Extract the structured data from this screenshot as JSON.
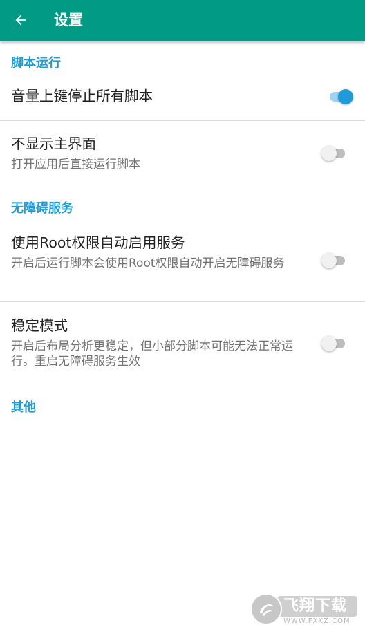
{
  "colors": {
    "appbar": "#009a85",
    "accent": "#1e9bd8",
    "title_text": "#212121",
    "summary_text": "#737373",
    "divider": "#dcdcdc"
  },
  "appbar": {
    "back_icon": "arrow-left-icon",
    "title": "设置"
  },
  "sections": [
    {
      "header": "脚本运行",
      "prefs": [
        {
          "title": "音量上键停止所有脚本",
          "summary": "",
          "switch_on": true
        },
        {
          "title": "不显示主界面",
          "summary": "打开应用后直接运行脚本",
          "switch_on": false
        }
      ]
    },
    {
      "header": "无障碍服务",
      "prefs": [
        {
          "title": "使用Root权限自动启用服务",
          "summary": "开启后运行脚本会使用Root权限自动开启无障碍服务",
          "switch_on": false
        },
        {
          "title": "稳定模式",
          "summary": "开启后布局分析更稳定，但小部分脚本可能无法正常运行。重启无障碍服务生效",
          "switch_on": false
        }
      ]
    },
    {
      "header": "其他",
      "prefs": []
    }
  ],
  "watermark": {
    "text": "飞翔下载",
    "domain": "WWW.FXXZ.COM"
  }
}
